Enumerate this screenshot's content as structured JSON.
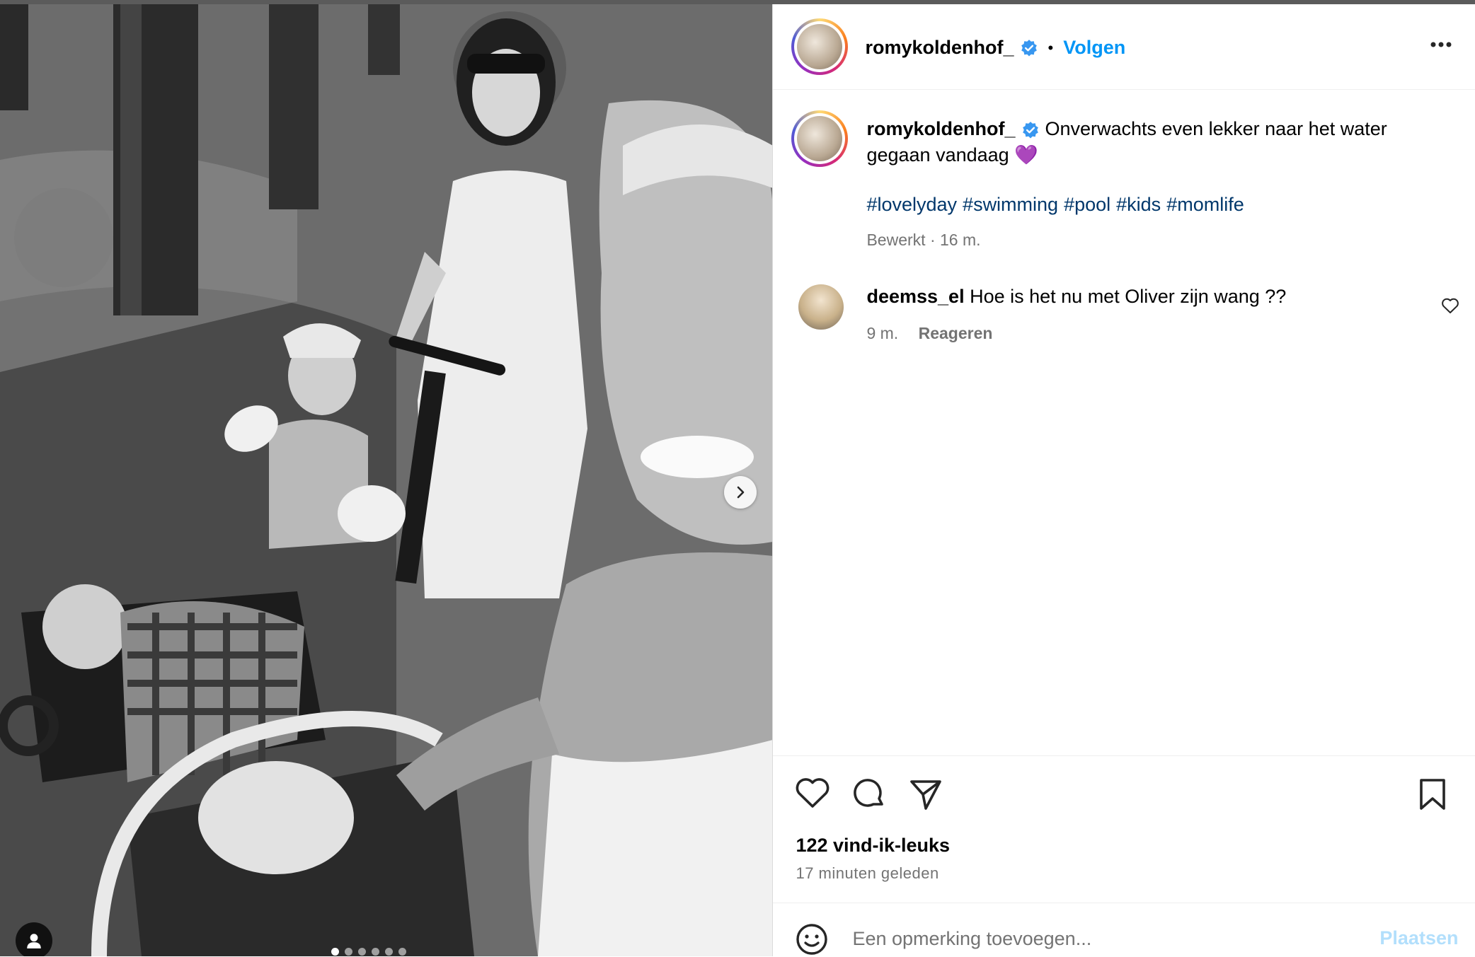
{
  "post": {
    "author": {
      "username": "romykoldenhof_",
      "verified": true,
      "follow_label": "Volgen",
      "separator": "•"
    },
    "caption": {
      "text": "Onverwachts even lekker naar het water gegaan vandaag",
      "emoji": "💜",
      "hashtags": [
        "#lovelyday",
        "#swimming",
        "#pool",
        "#kids",
        "#momlife"
      ],
      "edited_label": "Bewerkt",
      "meta_separator": "·",
      "time": "16 m."
    },
    "comments": [
      {
        "username": "deemss_el",
        "text": "Hoe is het nu met Oliver zijn wang ??",
        "time": "9 m.",
        "reply_label": "Reageren"
      }
    ],
    "likes_label": "122 vind-ik-leuks",
    "time_ago": "17 minuten geleden",
    "carousel": {
      "slide_count": 6,
      "active_index": 0
    },
    "add_comment": {
      "placeholder": "Een opmerking toevoegen...",
      "post_label": "Plaatsen"
    }
  },
  "icons": {
    "verified": "verified-badge-icon",
    "more": "more-options-icon",
    "like": "heart-icon",
    "comment": "comment-icon",
    "share": "share-icon",
    "save": "bookmark-icon",
    "emoji": "emoji-icon",
    "next": "chevron-right-icon",
    "tag": "user-tag-icon"
  },
  "colors": {
    "accent": "#0095f6",
    "hashtag": "#00376b",
    "muted": "#737373",
    "post_disabled": "#b2dffc"
  }
}
